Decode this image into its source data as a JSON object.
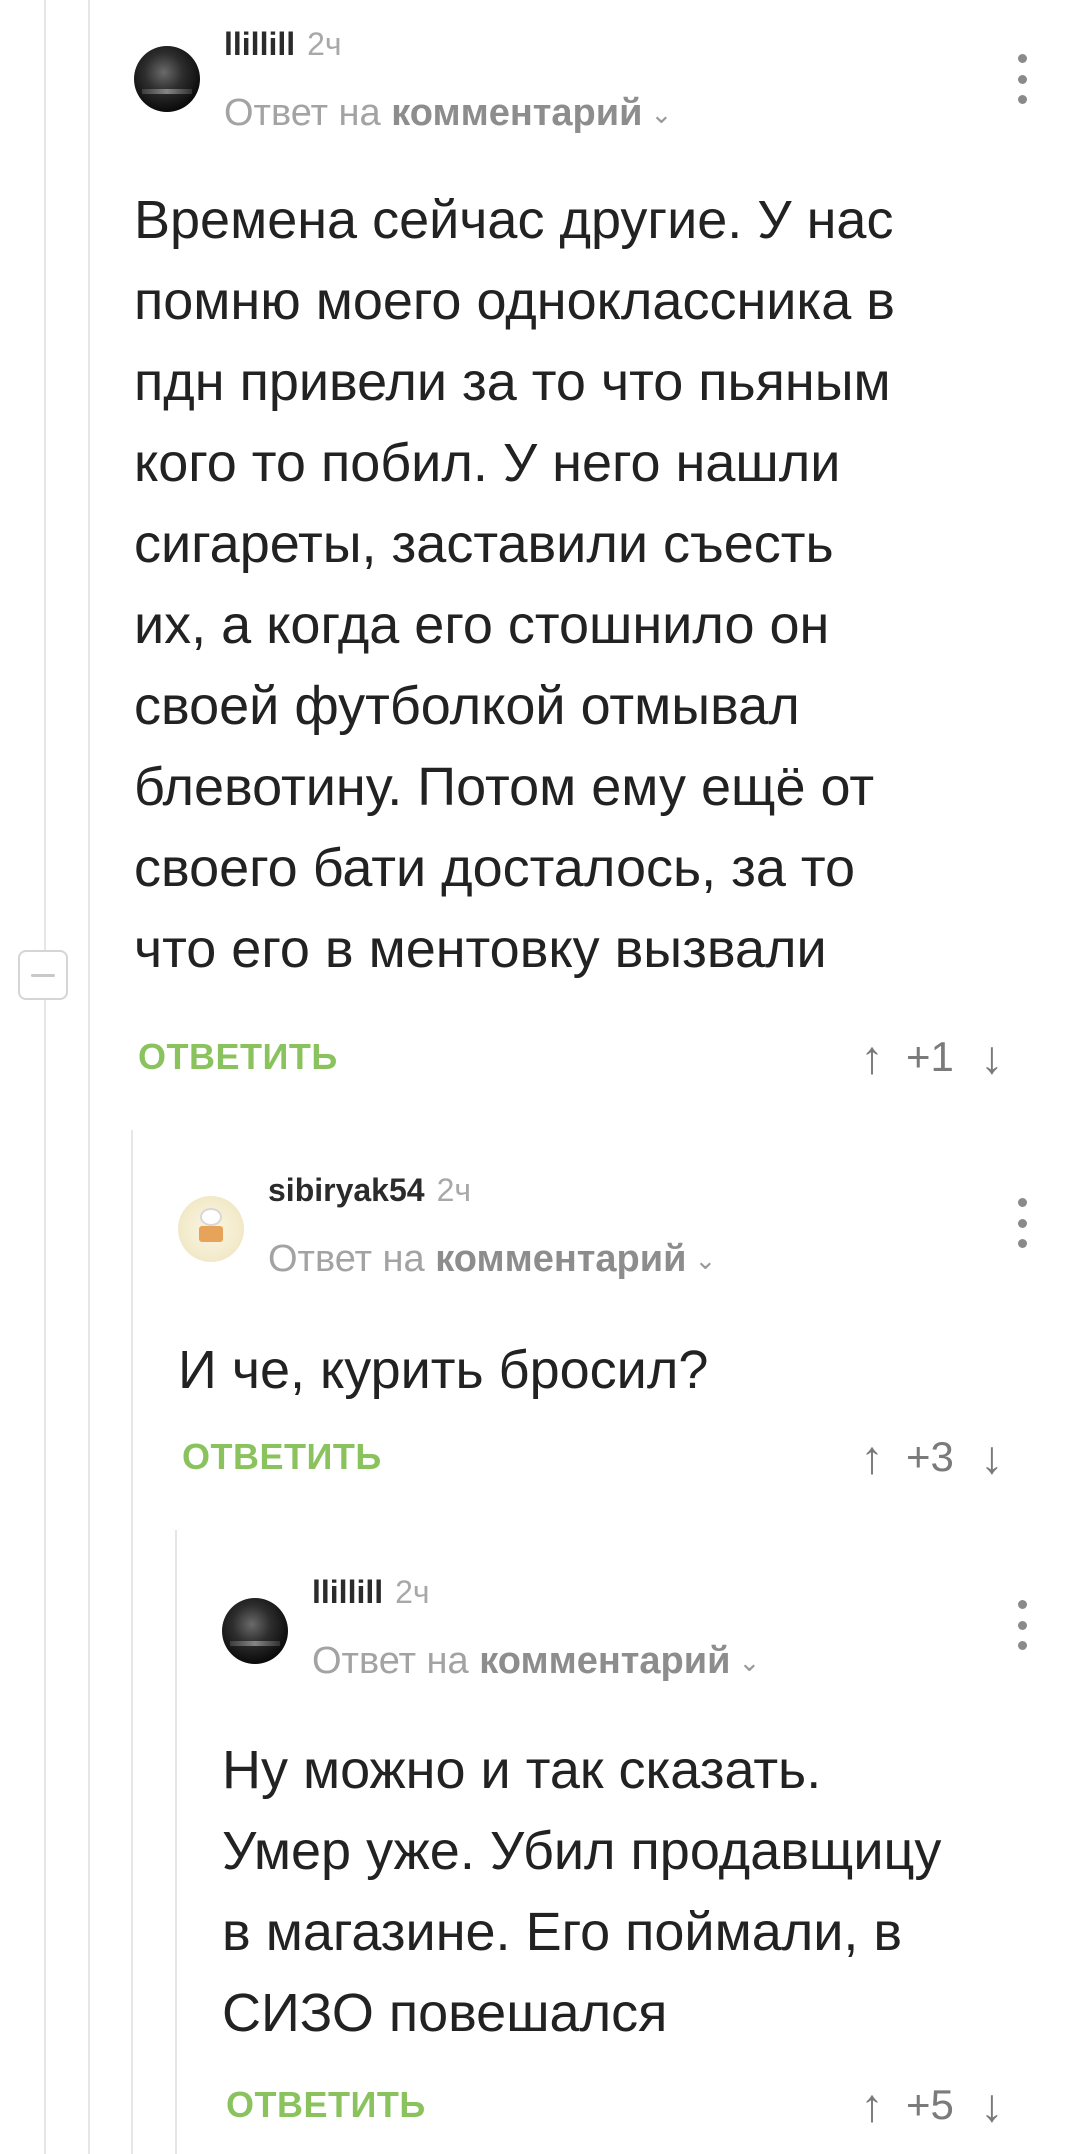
{
  "comments": [
    {
      "username": "llillill",
      "time": "2ч",
      "reply_prefix": "Ответ на",
      "reply_target": "комментарий",
      "text": "Времена сейчас другие. У нас\nпомню моего одноклассника в\nпдн привели за то что пьяным\nкого то побил. У него нашли\nсигареты, заставили съесть\nих, а когда его стошнило он\nсвоей футболкой отмывал\nблевотину. Потом ему ещё от\nсвоего бати досталось, за то\nчто его в ментовку вызвали",
      "reply_label": "ОТВЕТИТЬ",
      "score": "+1"
    },
    {
      "username": "sibiryak54",
      "time": "2ч",
      "reply_prefix": "Ответ на",
      "reply_target": "комментарий",
      "text": "И че, курить бросил?",
      "reply_label": "ОТВЕТИТЬ",
      "score": "+3"
    },
    {
      "username": "llillill",
      "time": "2ч",
      "reply_prefix": "Ответ на",
      "reply_target": "комментарий",
      "text": "Ну можно и так сказать.\nУмер уже. Убил продавщицу\nв магазине. Его поймали, в\nСИЗО повешался",
      "reply_label": "ОТВЕТИТЬ",
      "score": "+5"
    }
  ],
  "icons": {
    "upvote": "↑",
    "downvote": "↓",
    "chevron": "⌄",
    "collapse": "minus"
  },
  "colors": {
    "reply_green": "#8ac35e",
    "thread_line": "#e6e6e6"
  }
}
